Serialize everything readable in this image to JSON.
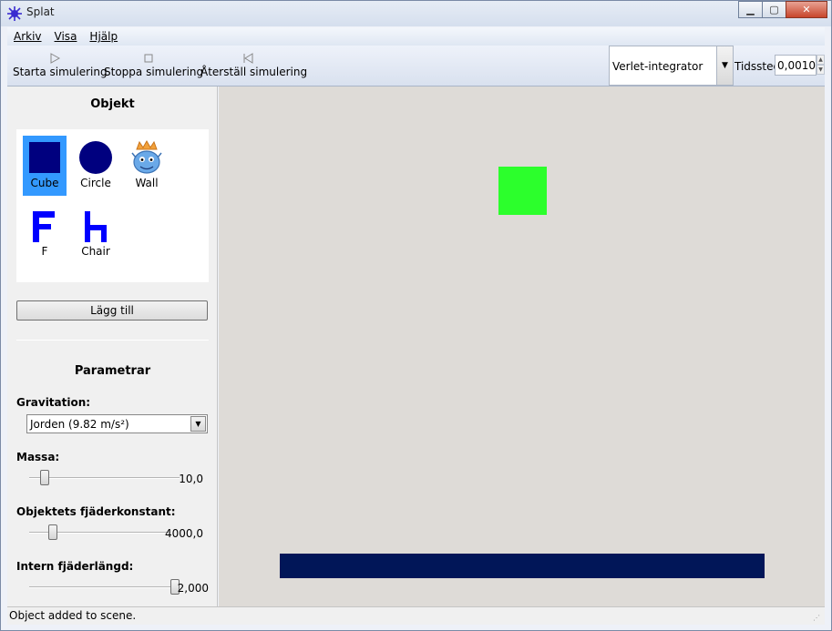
{
  "window": {
    "title": "Splat"
  },
  "menu": {
    "items": [
      "Arkiv",
      "Visa",
      "Hjälp"
    ]
  },
  "toolbar": {
    "start": "Starta simulering",
    "stop": "Stoppa simulering",
    "reset": "Återställ simulering",
    "integrator": "Verlet-integrator",
    "timestep_label": "Tidssteg",
    "timestep_value": "0,0010"
  },
  "objects": {
    "title": "Objekt",
    "items": [
      {
        "label": "Cube",
        "selected": true,
        "icon": "cube-icon",
        "color": "#00007f"
      },
      {
        "label": "Circle",
        "selected": false,
        "icon": "circle-icon",
        "color": "#00007f"
      },
      {
        "label": "Wall",
        "selected": false,
        "icon": "wall-mascot-icon"
      },
      {
        "label": "F",
        "selected": false,
        "icon": "f-shape-icon",
        "color": "#0000ff"
      },
      {
        "label": "Chair",
        "selected": false,
        "icon": "chair-shape-icon",
        "color": "#0000ff"
      }
    ],
    "add_button": "Lägg till"
  },
  "parameters": {
    "title": "Parametrar",
    "gravity_label": "Gravitation:",
    "gravity_value": "Jorden (9.82 m/s²)",
    "mass_label": "Massa:",
    "mass_value": "10,0",
    "mass_level": 0.08,
    "spring_label": "Objektets fjäderkonstant:",
    "spring_value": "4000,0",
    "spring_level": 0.15,
    "length_label": "Intern fjäderlängd:",
    "length_value": "2,000",
    "length_level": 1.0
  },
  "scene": {
    "cube_color": "#2cff2c",
    "wall_color": "#011658",
    "background": "#dedbd7"
  },
  "status": {
    "message": "Object added to scene."
  }
}
